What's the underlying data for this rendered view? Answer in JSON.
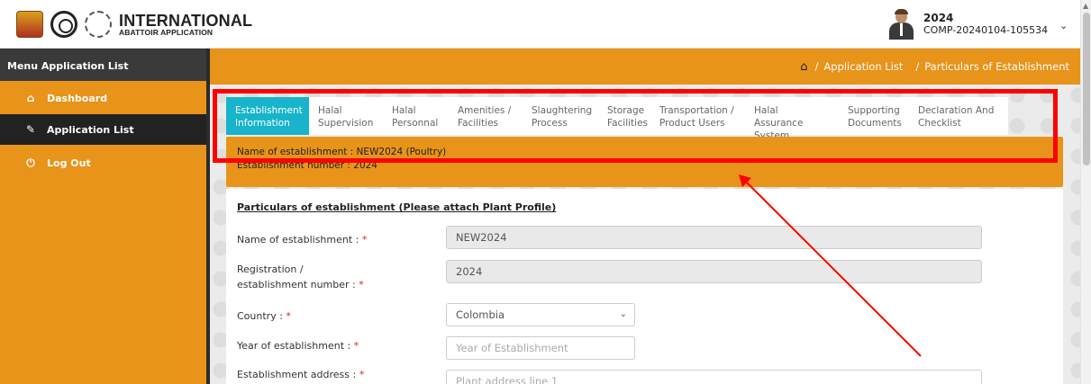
{
  "header": {
    "brand_title": "INTERNATIONAL",
    "brand_subtitle": "ABATTOIR APPLICATION",
    "user_name": "2024",
    "user_code": "COMP-20240104-105534"
  },
  "sidebar": {
    "title": "Menu Application List",
    "items": [
      {
        "label": "Dashboard",
        "icon": "home-icon"
      },
      {
        "label": "Application List",
        "icon": "edit-icon"
      },
      {
        "label": "Log Out",
        "icon": "power-icon"
      }
    ]
  },
  "breadcrumb": {
    "sep1": "/",
    "item1": "Application List",
    "sep2": "/",
    "item2": "Particulars of Establishment"
  },
  "tabs": [
    {
      "line1": "Establishment",
      "line2": "Information"
    },
    {
      "line1": "Halal",
      "line2": "Supervision"
    },
    {
      "line1": "Halal",
      "line2": "Personnal"
    },
    {
      "line1": "Amenities /",
      "line2": "Facilities"
    },
    {
      "line1": "Slaughtering",
      "line2": "Process"
    },
    {
      "line1": "Storage",
      "line2": "Facilities"
    },
    {
      "line1": "Transportation /",
      "line2": "Product Users"
    },
    {
      "line1": "Halal Assurance",
      "line2": "System"
    },
    {
      "line1": "Supporting",
      "line2": "Documents"
    },
    {
      "line1": "Declaration And",
      "line2": "Checklist"
    }
  ],
  "establishment": {
    "name_line": "Name of establishment : NEW2024 (Poultry)",
    "number_line": "Establishment number  : 2024"
  },
  "form": {
    "section_title": "Particulars of establishment (Please attach Plant Profile)",
    "name_label": "Name of establishment : ",
    "name_value": "NEW2024",
    "reg_label_1": "Registration /",
    "reg_label_2": "establishment number : ",
    "reg_value": "2024",
    "country_label": "Country : ",
    "country_value": "Colombia",
    "year_label": "Year of establishment : ",
    "year_placeholder": "Year of Establishment",
    "address_label": "Establishment address : ",
    "address_placeholder": "Plant address line 1",
    "required_mark": "*"
  },
  "colors": {
    "accent_orange": "#e8931a",
    "active_tab": "#17b4cc",
    "dark": "#222222",
    "annotation_red": "#ff0000"
  }
}
